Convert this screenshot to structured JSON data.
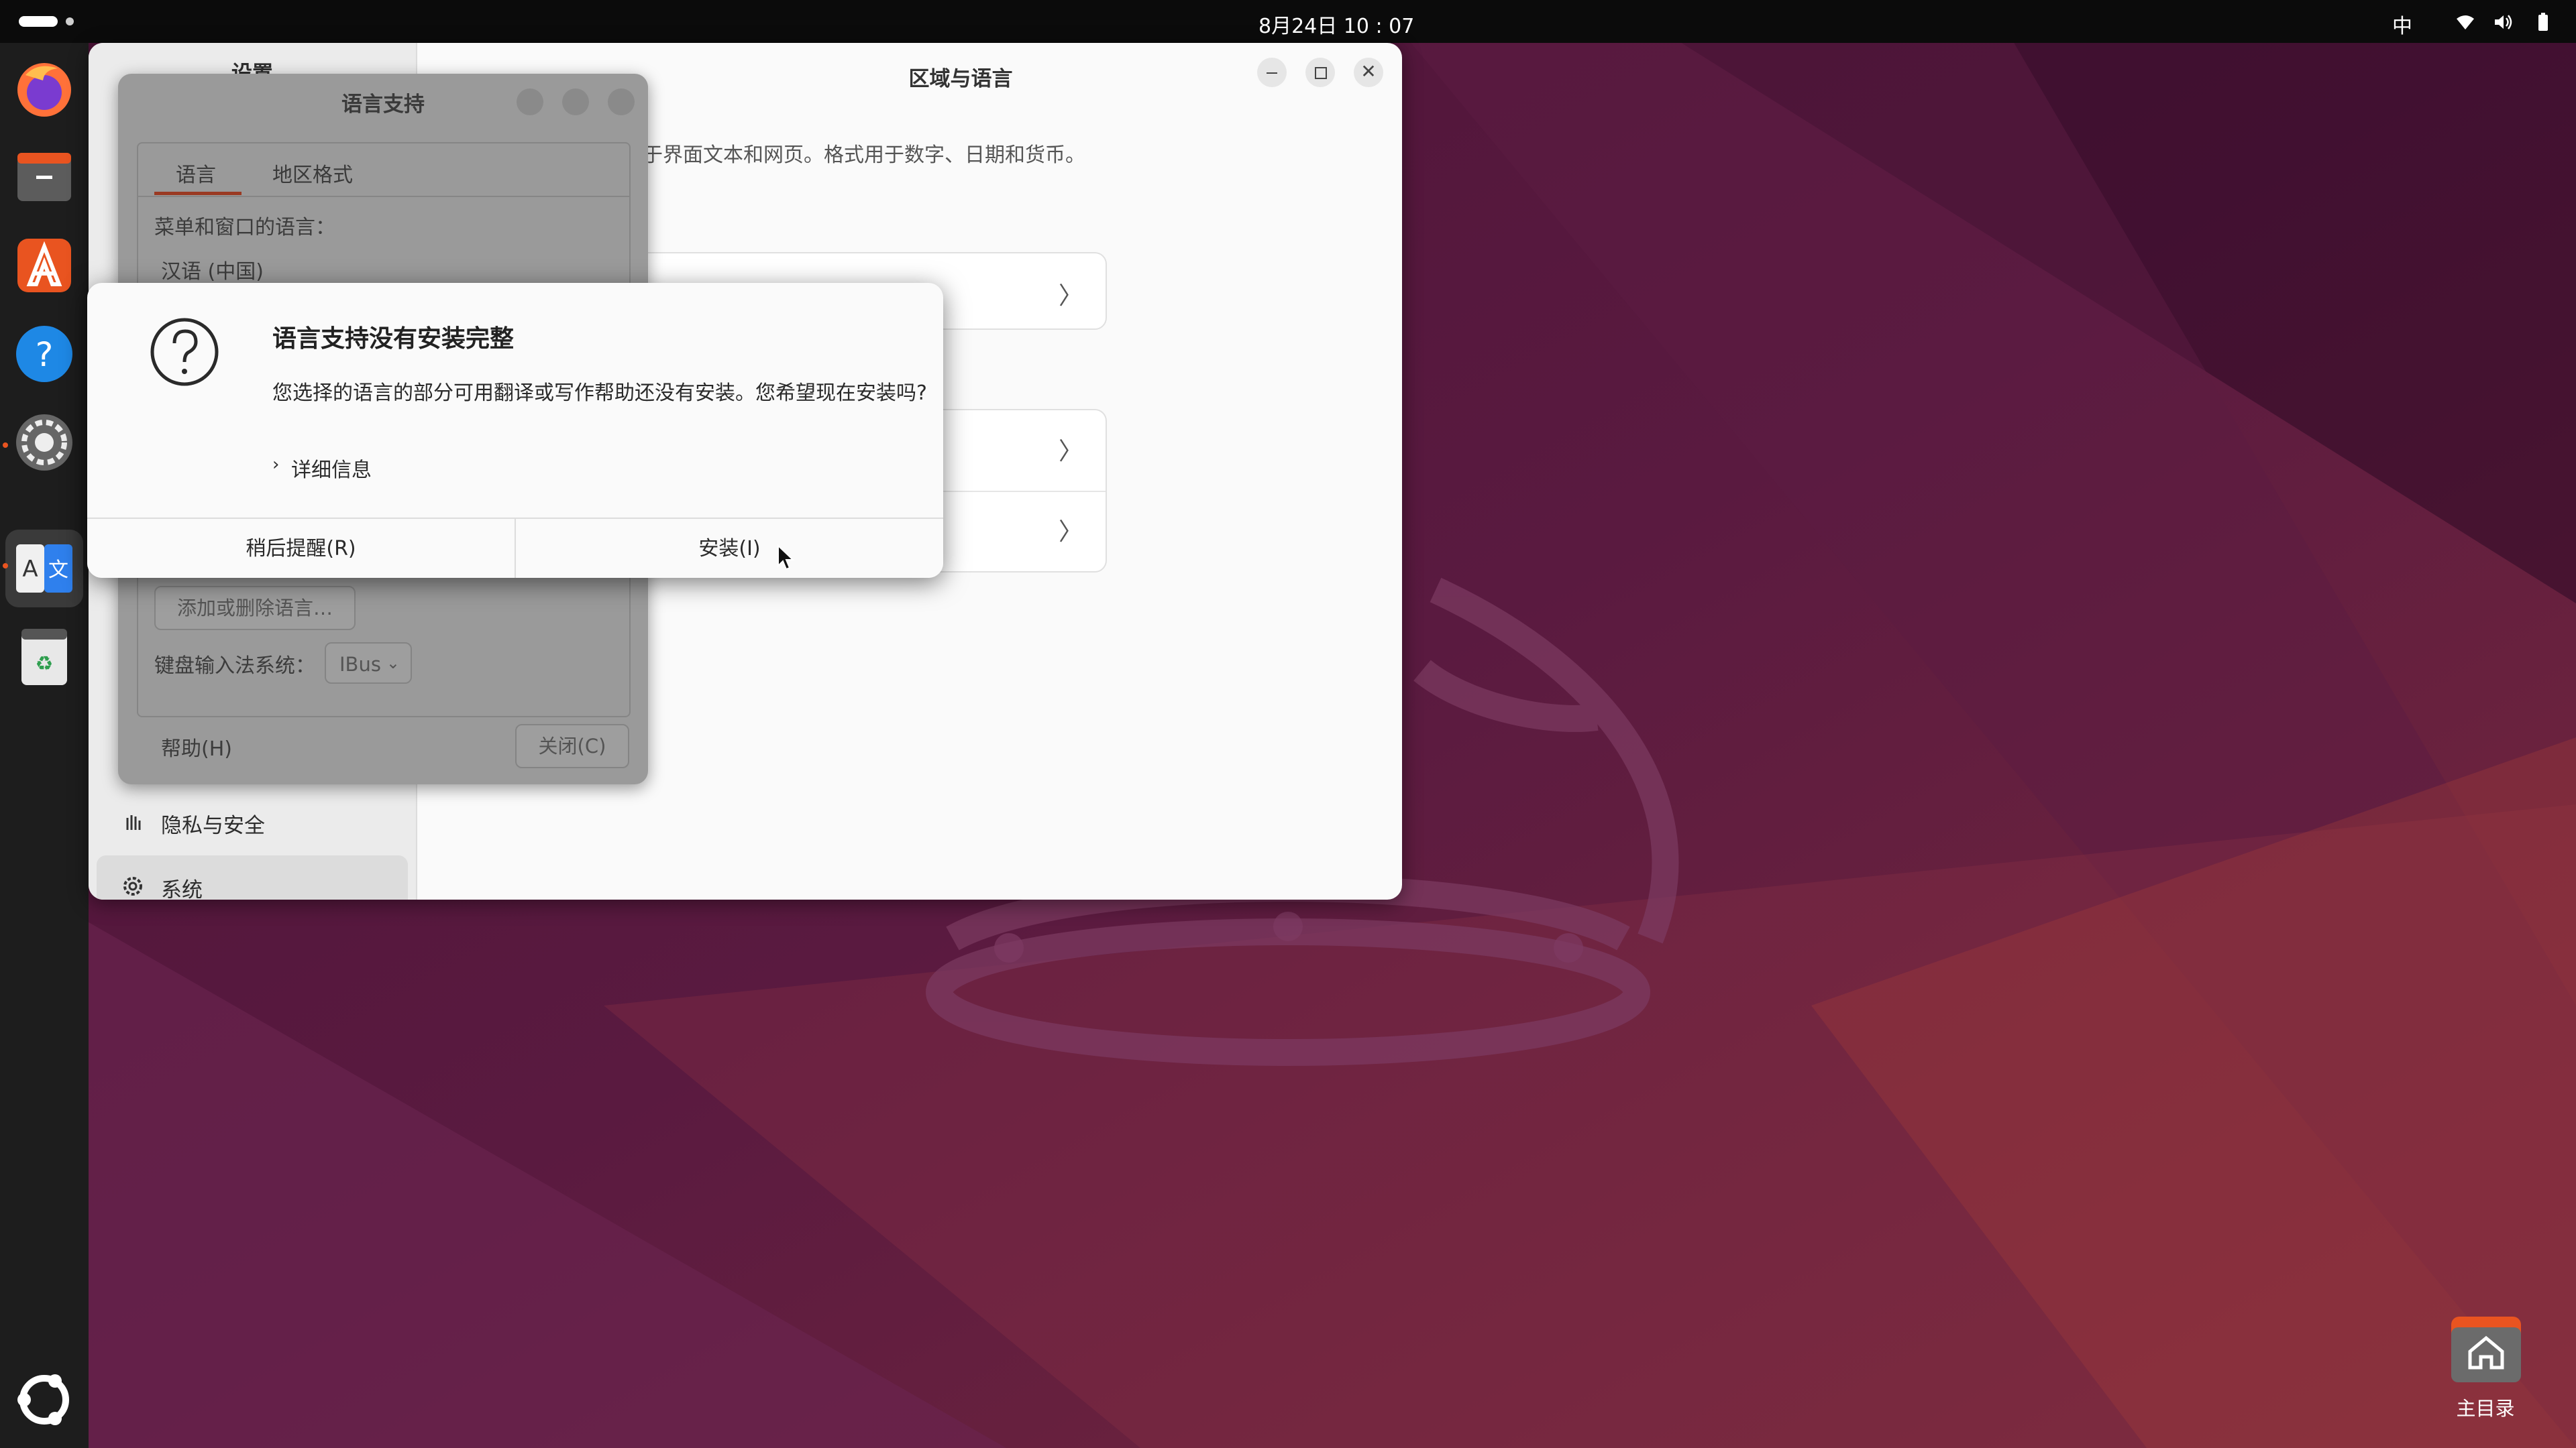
{
  "topbar": {
    "clock": "8月24日 10 : 07",
    "ime": "中"
  },
  "dock": {
    "items": [
      "firefox-icon",
      "files-icon",
      "app-center-icon",
      "help-icon",
      "settings-icon",
      "language-support-icon",
      "trash-icon"
    ],
    "apps_grid_icon": "ubuntu-logo-icon"
  },
  "desktop": {
    "home_folder_label": "主目录"
  },
  "settings": {
    "title": "设置",
    "page_title": "区域与语言",
    "description": "于界面文本和网页。格式用于数字、日期和货币。",
    "sidebar": {
      "privacy": "隐私与安全",
      "system": "系统"
    }
  },
  "language_support": {
    "title": "语言支持",
    "tabs": [
      "语言",
      "地区格式"
    ],
    "menu_language_label": "菜单和窗口的语言：",
    "current_language": "汉语 (中国)",
    "add_remove_button": "添加或删除语言…",
    "input_method_label": "键盘输入法系统：",
    "input_method_value": "IBus",
    "help_button": "帮助(H)",
    "close_button": "关闭(C)"
  },
  "modal": {
    "heading": "语言支持没有安装完整",
    "body": "您选择的语言的部分可用翻译或写作帮助还没有安装。您希望现在安装吗?",
    "details": "详细信息",
    "remind_later": "稍后提醒(R)",
    "install": "安装(I)"
  },
  "colors": {
    "accent": "#e95420",
    "wallpaper_dark": "#3b0d2b",
    "wallpaper_mid": "#6a1f48"
  }
}
